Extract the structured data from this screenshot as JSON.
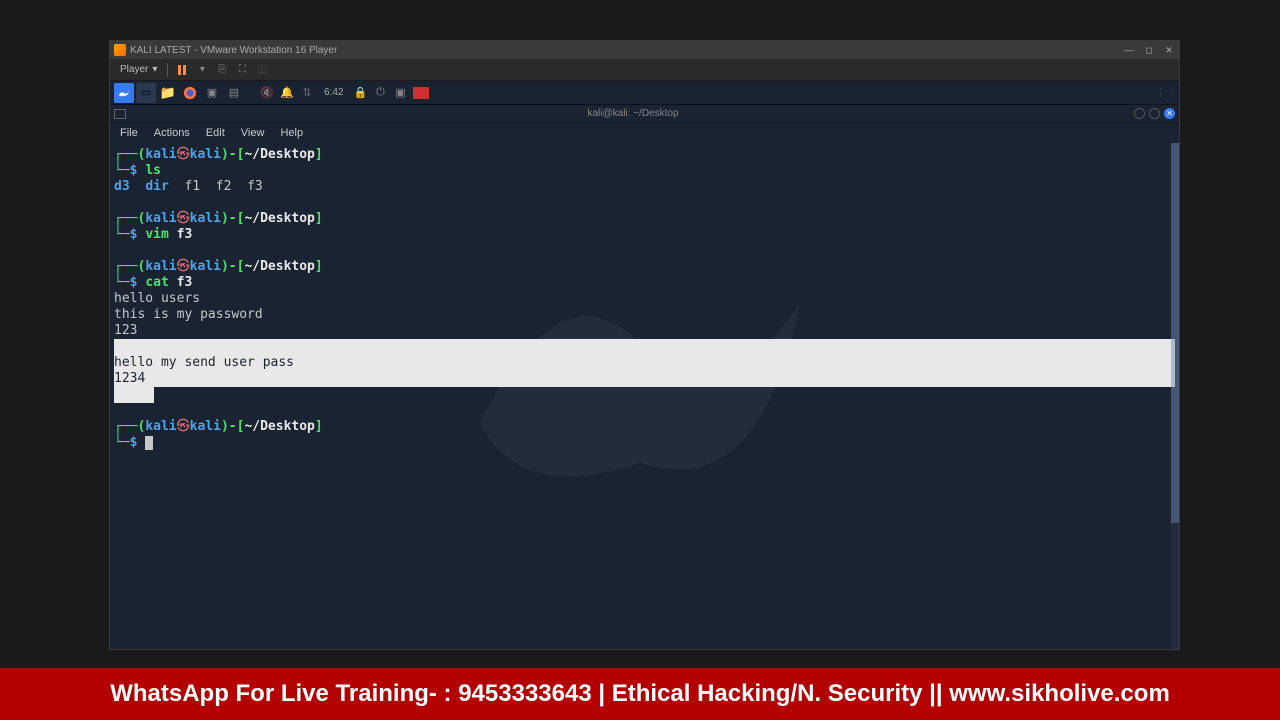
{
  "vmware": {
    "title": "KALI LATEST - VMware Workstation 16 Player",
    "player_menu": "Player"
  },
  "kali_panel": {
    "time": "6:42"
  },
  "terminal": {
    "title": "kali@kali: ~/Desktop",
    "menu": {
      "file": "File",
      "actions": "Actions",
      "edit": "Edit",
      "view": "View",
      "help": "Help"
    },
    "prompt": {
      "user": "kali",
      "host": "kali",
      "path": "~/Desktop",
      "lp": "(",
      "at": "㉿",
      "rp": ")",
      "dash": "-",
      "lb": "[",
      "rb": "]",
      "dollar": "$"
    },
    "cmd1": "ls",
    "ls_out": {
      "d3": "d3",
      "dir": "dir",
      "f1": "f1",
      "f2": "f2",
      "f3": "f3"
    },
    "cmd2": "vim",
    "cmd2_arg": "f3",
    "cmd3": "cat",
    "cmd3_arg": "f3",
    "cat_out": {
      "l1": "hello users",
      "l2": "this is my password",
      "l3": "123",
      "l4_blank": " ",
      "l5": "hello my send user pass",
      "l6": "1234",
      "l7_partial": "     "
    }
  },
  "footer": {
    "text": "WhatsApp For Live Training- : 9453333643 | Ethical Hacking/N. Security || www.sikholive.com"
  }
}
